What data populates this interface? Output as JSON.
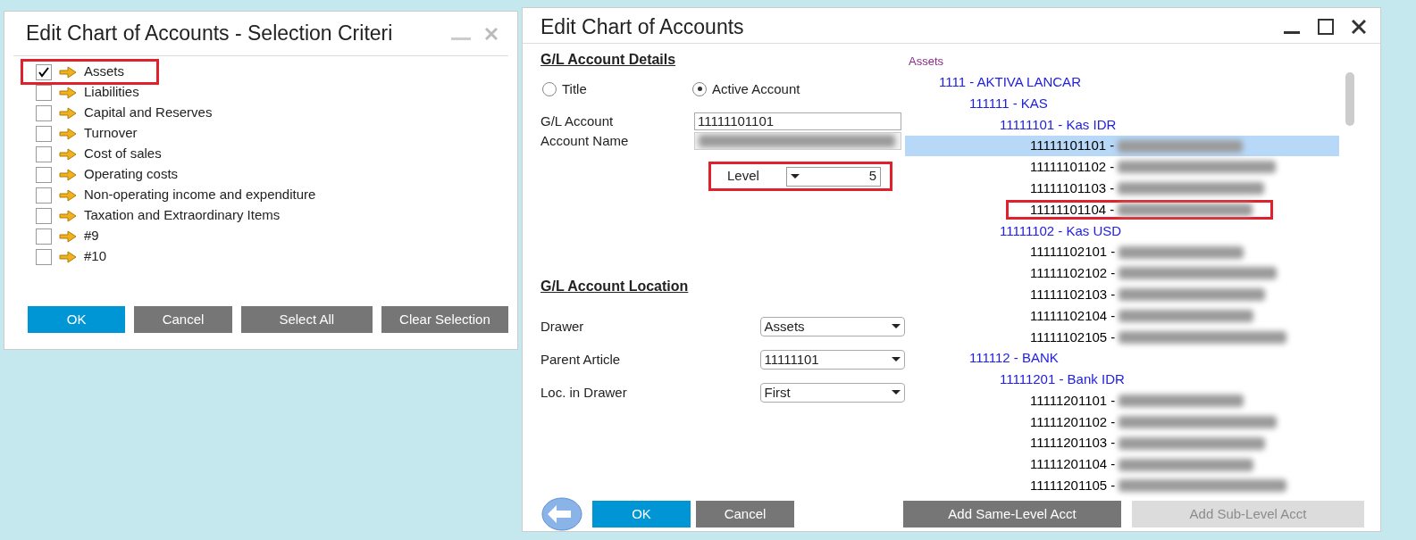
{
  "selection_dialog": {
    "title": "Edit Chart of Accounts - Selection Criteri",
    "items": [
      {
        "label": "Assets",
        "checked": true,
        "highlighted": true
      },
      {
        "label": "Liabilities",
        "checked": false,
        "highlighted": false
      },
      {
        "label": "Capital and Reserves",
        "checked": false,
        "highlighted": false
      },
      {
        "label": "Turnover",
        "checked": false,
        "highlighted": false
      },
      {
        "label": "Cost of sales",
        "checked": false,
        "highlighted": false
      },
      {
        "label": "Operating costs",
        "checked": false,
        "highlighted": false
      },
      {
        "label": "Non-operating income and expenditure",
        "checked": false,
        "highlighted": false
      },
      {
        "label": "Taxation and Extraordinary Items",
        "checked": false,
        "highlighted": false
      },
      {
        "label": "#9",
        "checked": false,
        "highlighted": false
      },
      {
        "label": "#10",
        "checked": false,
        "highlighted": false
      }
    ],
    "buttons": [
      {
        "label": "OK",
        "kind": "primary"
      },
      {
        "label": "Cancel",
        "kind": "secondary"
      },
      {
        "label": "Select All",
        "kind": "secondary"
      },
      {
        "label": "Clear Selection",
        "kind": "secondary"
      }
    ]
  },
  "edit_dialog": {
    "title": "Edit Chart of Accounts",
    "details_heading": "G/L Account Details",
    "account_type": [
      {
        "label": "Title",
        "selected": false
      },
      {
        "label": "Active Account",
        "selected": true
      }
    ],
    "gl_account": {
      "label": "G/L Account",
      "value": "11111101101"
    },
    "account_name": {
      "label": "Account Name"
    },
    "level": {
      "label": "Level",
      "value": "5",
      "highlighted": true
    },
    "location_heading": "G/L Account Location",
    "location_fields": [
      {
        "label": "Drawer",
        "value": "Assets"
      },
      {
        "label": "Parent Article",
        "value": "11111101"
      },
      {
        "label": "Loc. in Drawer",
        "value": "First"
      }
    ],
    "tree": [
      {
        "label": "Assets",
        "kind": "drawer",
        "children": [
          {
            "label": "1111 - AKTIVA LANCAR",
            "kind": "title",
            "children": [
              {
                "label": "111111 - KAS",
                "kind": "title",
                "children": [
                  {
                    "label": "11111101 - Kas IDR",
                    "kind": "title",
                    "children": [
                      {
                        "label": "11111101101 -",
                        "kind": "account",
                        "selected": true,
                        "highlighted": false
                      },
                      {
                        "label": "11111101102 -",
                        "kind": "account",
                        "selected": false,
                        "highlighted": false
                      },
                      {
                        "label": "11111101103 -",
                        "kind": "account",
                        "selected": false,
                        "highlighted": false
                      },
                      {
                        "label": "11111101104 -",
                        "kind": "account",
                        "selected": false,
                        "highlighted": true
                      }
                    ]
                  },
                  {
                    "label": "11111102 - Kas USD",
                    "kind": "title",
                    "children": [
                      {
                        "label": "11111102101 -",
                        "kind": "account",
                        "selected": false,
                        "highlighted": false
                      },
                      {
                        "label": "11111102102 -",
                        "kind": "account",
                        "selected": false,
                        "highlighted": false
                      },
                      {
                        "label": "11111102103 -",
                        "kind": "account",
                        "selected": false,
                        "highlighted": false
                      },
                      {
                        "label": "11111102104 -",
                        "kind": "account",
                        "selected": false,
                        "highlighted": false
                      },
                      {
                        "label": "11111102105 -",
                        "kind": "account",
                        "selected": false,
                        "highlighted": false
                      }
                    ]
                  }
                ]
              },
              {
                "label": "111112 - BANK",
                "kind": "title",
                "children": [
                  {
                    "label": "11111201 - Bank IDR",
                    "kind": "title",
                    "children": [
                      {
                        "label": "11111201101 -",
                        "kind": "account",
                        "selected": false,
                        "highlighted": false
                      },
                      {
                        "label": "11111201102 -",
                        "kind": "account",
                        "selected": false,
                        "highlighted": false
                      },
                      {
                        "label": "11111201103 -",
                        "kind": "account",
                        "selected": false,
                        "highlighted": false
                      },
                      {
                        "label": "11111201104 -",
                        "kind": "account",
                        "selected": false,
                        "highlighted": false
                      },
                      {
                        "label": "11111201105 -",
                        "kind": "account",
                        "selected": false,
                        "highlighted": false
                      }
                    ]
                  }
                ]
              }
            ]
          }
        ]
      }
    ],
    "buttons": [
      {
        "label": "OK",
        "kind": "primary"
      },
      {
        "label": "Cancel",
        "kind": "secondary"
      },
      {
        "label": "Add Same-Level Acct",
        "kind": "secondary"
      },
      {
        "label": "Add Sub-Level Acct",
        "kind": "disabled"
      }
    ]
  }
}
